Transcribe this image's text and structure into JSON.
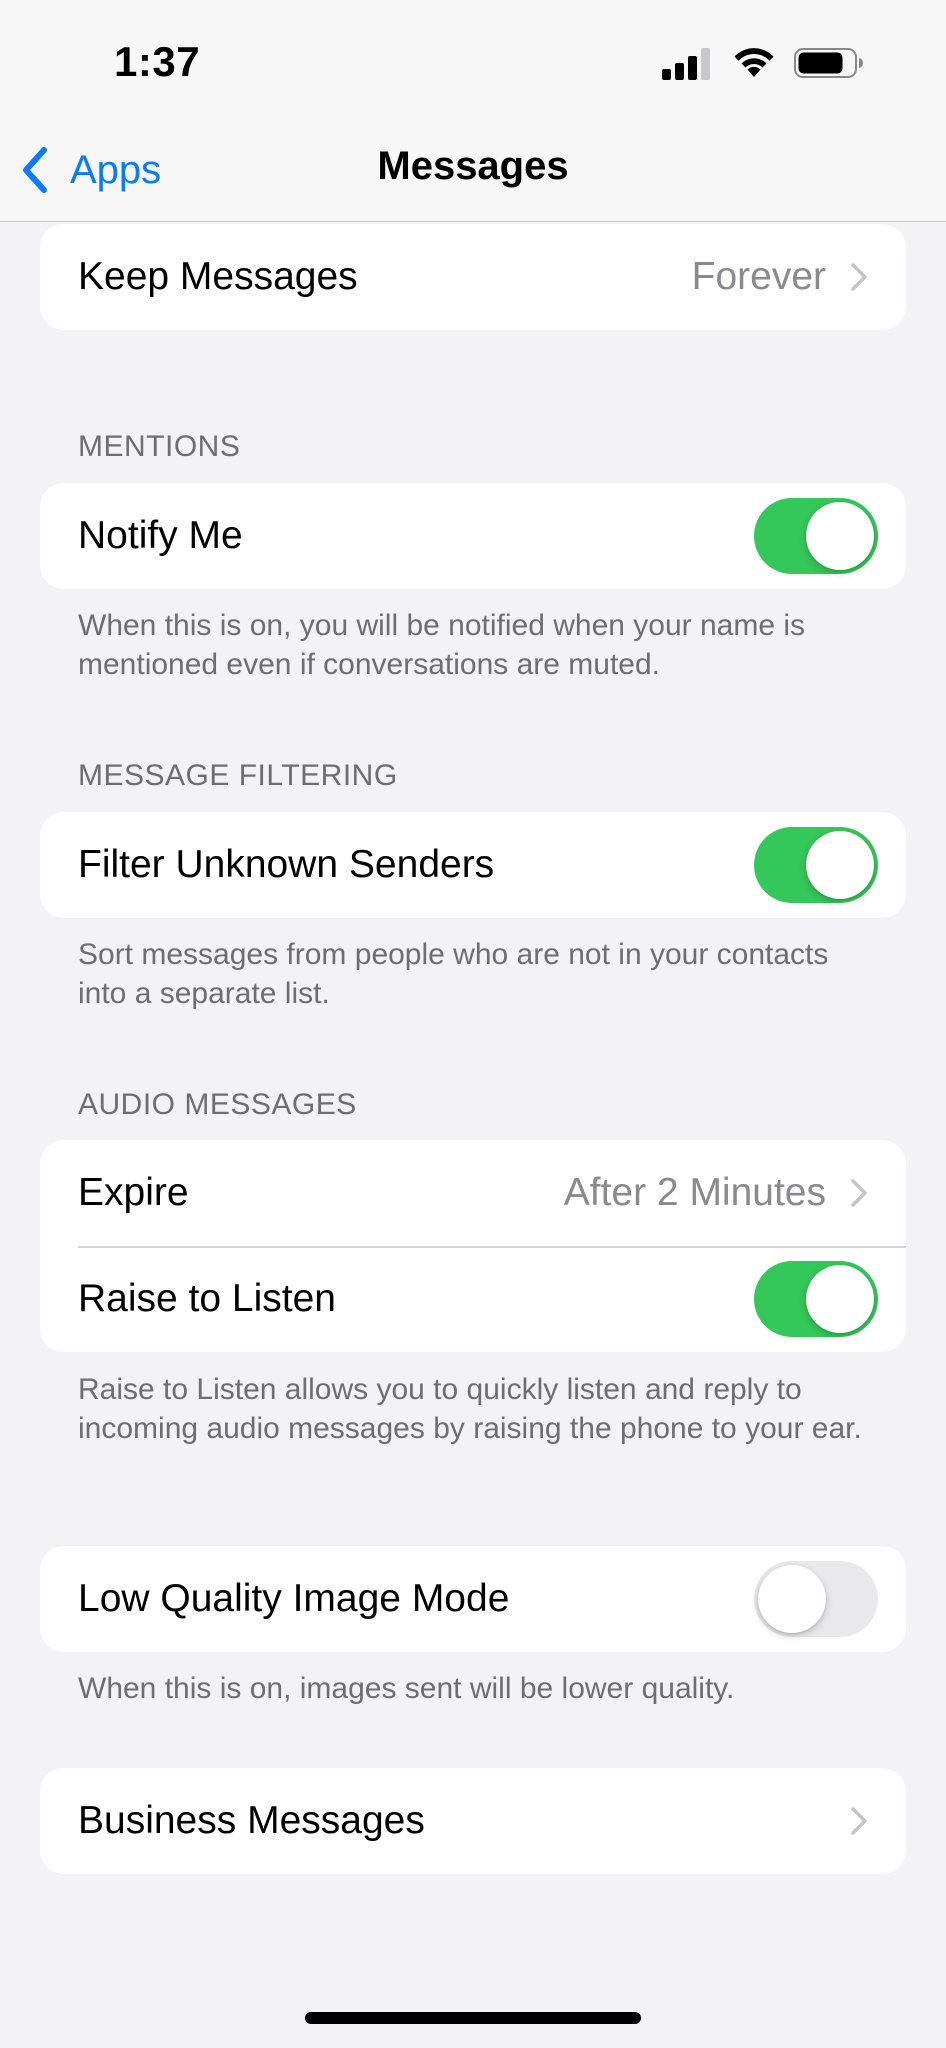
{
  "status_bar": {
    "time": "1:37"
  },
  "nav": {
    "back_label": "Apps",
    "title": "Messages"
  },
  "keep_messages": {
    "label": "Keep Messages",
    "value": "Forever"
  },
  "mentions": {
    "header": "MENTIONS",
    "notify_me": {
      "label": "Notify Me",
      "on": true
    },
    "footer": "When this is on, you will be notified when your name is mentioned even if conversations are muted."
  },
  "message_filtering": {
    "header": "MESSAGE FILTERING",
    "filter_unknown": {
      "label": "Filter Unknown Senders",
      "on": true
    },
    "footer": "Sort messages from people who are not in your contacts into a separate list."
  },
  "audio_messages": {
    "header": "AUDIO MESSAGES",
    "expire": {
      "label": "Expire",
      "value": "After 2 Minutes"
    },
    "raise_to_listen": {
      "label": "Raise to Listen",
      "on": true
    },
    "footer": "Raise to Listen allows you to quickly listen and reply to incoming audio messages by raising the phone to your ear."
  },
  "low_quality": {
    "label": "Low Quality Image Mode",
    "on": false,
    "footer": "When this is on, images sent will be lower quality."
  },
  "business_messages": {
    "label": "Business Messages"
  },
  "colors": {
    "accent": "#0a7aff",
    "toggle_on": "#34c759",
    "background": "#f2f2f7"
  }
}
